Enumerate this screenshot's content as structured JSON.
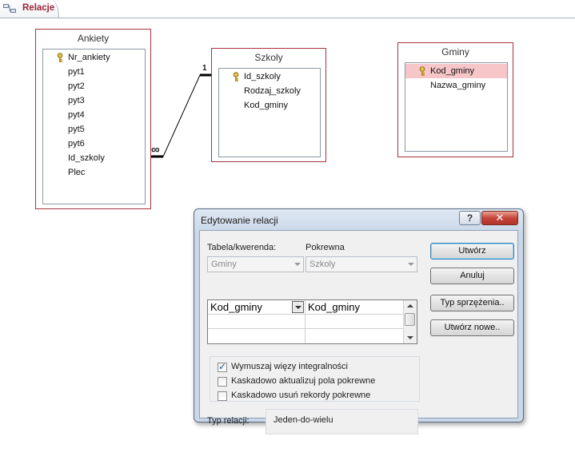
{
  "tab": {
    "label": "Relacje"
  },
  "tables": {
    "ankiety": {
      "title": "Ankiety",
      "fields": [
        "Nr_ankiety",
        "pyt1",
        "pyt2",
        "pyt3",
        "pyt4",
        "pyt5",
        "pyt6",
        "Id_szkoly",
        "Plec"
      ]
    },
    "szkoly": {
      "title": "Szkoly",
      "fields": [
        "Id_szkoly",
        "Rodzaj_szkoly",
        "Kod_gminy"
      ]
    },
    "gminy": {
      "title": "Gminy",
      "fields": [
        "Kod_gminy",
        "Nazwa_gminy"
      ]
    }
  },
  "relationship": {
    "one_label": "1",
    "many_label": "∞"
  },
  "dialog": {
    "title": "Edytowanie relacji",
    "help": "?",
    "close": "✕",
    "table_label": "Tabela/kwerenda:",
    "related_label": "Pokrewna",
    "table_value": "Gminy",
    "related_value": "Szkoly",
    "grid_left": "Kod_gminy",
    "grid_right": "Kod_gminy",
    "checks": {
      "integrity": "Wymuszaj więzy integralności",
      "cascade_update": "Kaskadowo aktualizuj pola pokrewne",
      "cascade_delete": "Kaskadowo usuń rekordy pokrewne"
    },
    "reltype_label": "Typ relacji:",
    "reltype_value": "Jeden-do-wielu",
    "buttons": {
      "create": "Utwórz",
      "cancel": "Anuluj",
      "join": "Typ sprzężenia..",
      "new": "Utwórz nowe.."
    }
  }
}
